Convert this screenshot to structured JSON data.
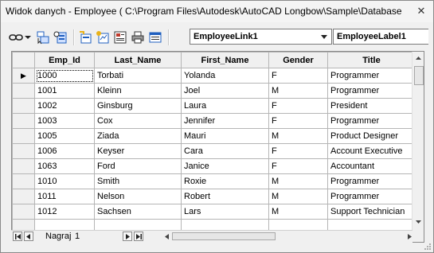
{
  "window": {
    "title": "Widok danych - Employee ( C:\\Program Files\\Autodesk\\AutoCAD Longbow\\Sample\\Database",
    "close_glyph": "✕"
  },
  "toolbar": {
    "link_dropdown": "EmployeeLink1",
    "label_dropdown": "EmployeeLabel1",
    "icons": [
      "link-icon",
      "dropdown-arrow-icon",
      "select-objects-icon",
      "find-record-icon",
      "link-template-icon",
      "label-template-icon",
      "query-icon",
      "print-icon",
      "format-icon"
    ]
  },
  "grid": {
    "columns": [
      "Emp_Id",
      "Last_Name",
      "First_Name",
      "Gender",
      "Title"
    ],
    "rows": [
      [
        "1000",
        "Torbati",
        "Yolanda",
        "F",
        "Programmer"
      ],
      [
        "1001",
        "Kleinn",
        "Joel",
        "M",
        "Programmer"
      ],
      [
        "1002",
        "Ginsburg",
        "Laura",
        "F",
        "President"
      ],
      [
        "1003",
        "Cox",
        "Jennifer",
        "F",
        "Programmer"
      ],
      [
        "1005",
        "Ziada",
        "Mauri",
        "M",
        "Product Designer"
      ],
      [
        "1006",
        "Keyser",
        "Cara",
        "F",
        "Account Executive"
      ],
      [
        "1063",
        "Ford",
        "Janice",
        "F",
        "Accountant"
      ],
      [
        "1010",
        "Smith",
        "Roxie",
        "M",
        "Programmer"
      ],
      [
        "1011",
        "Nelson",
        "Robert",
        "M",
        "Programmer"
      ],
      [
        "1012",
        "Sachsen",
        "Lars",
        "M",
        "Support Technician"
      ]
    ],
    "current_row_marker": "▶"
  },
  "navigation": {
    "record_label": "Nagraj",
    "record_value": "1"
  },
  "colors": {
    "window_bg": "#f0f0f0",
    "grid_line": "#b5b5b5",
    "icon_blue": "#1f5fbf",
    "icon_yellow": "#e8b21a"
  }
}
